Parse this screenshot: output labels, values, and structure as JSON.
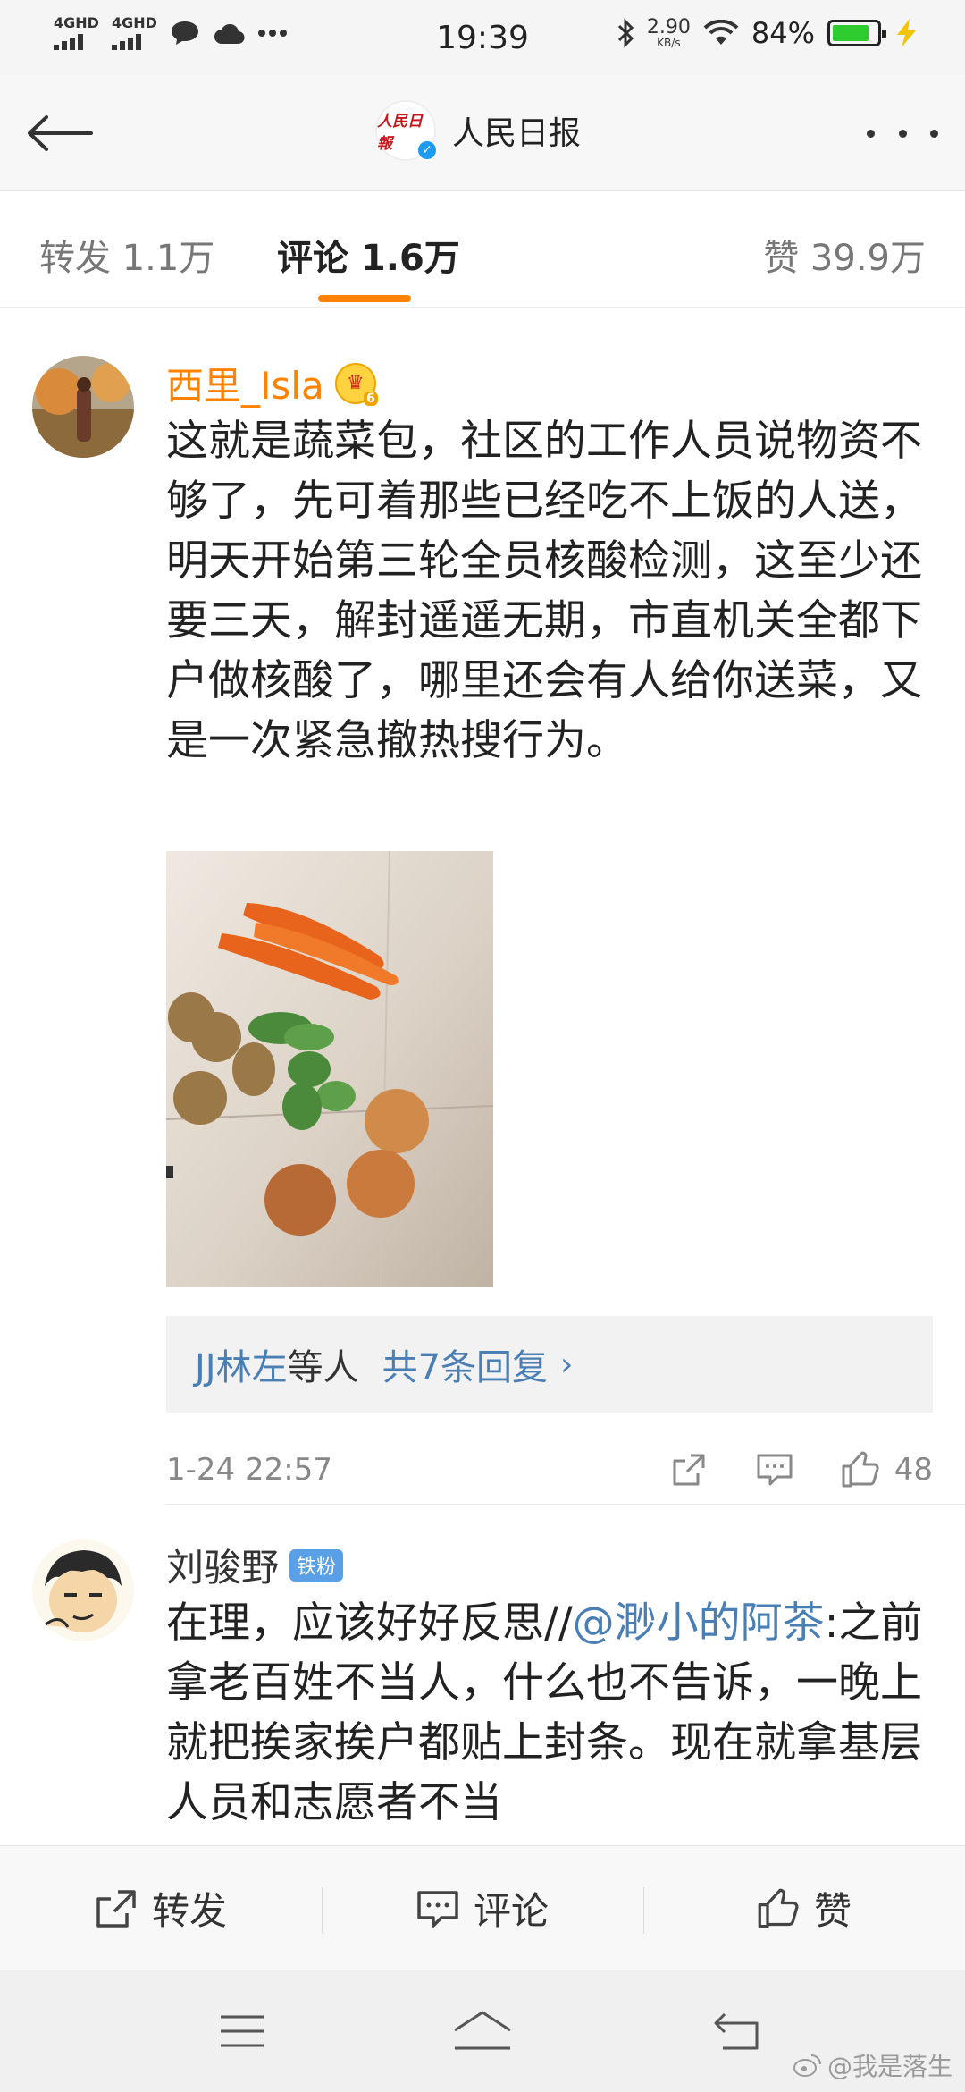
{
  "status_bar": {
    "network_1": "4GHD",
    "network_2": "4GHD",
    "time": "19:39",
    "speed_value": "2.90",
    "speed_unit": "KB/s",
    "battery_percent": "84%",
    "battery_level": 0.84,
    "battery_color": "#2ecc2e"
  },
  "header": {
    "title": "人民日报",
    "logo_text": "人民日報",
    "back_icon": "back-arrow-icon",
    "more_icon": "more-dots-icon"
  },
  "tabs": [
    {
      "label": "转发 1.1万"
    },
    {
      "label": "评论 1.6万"
    },
    {
      "label": "赞 39.9万"
    }
  ],
  "accent_color": "#ff8200",
  "comments": [
    {
      "username": "西里_Isla",
      "username_color": "#ff8200",
      "badge_number": "6",
      "text": "这就是蔬菜包，社区的工作人员说物资不够了，先可着那些已经吃不上饭的人送，明天开始第三轮全员核酸检测，这至少还要三天，解封遥遥无期，市直机关全都下户做核酸了，哪里还会有人给你送菜，又是一次紧急撤热搜行为。",
      "reply_names": "JJ林左",
      "reply_etc": "等人",
      "reply_count": "共7条回复",
      "time": "1-24 22:57",
      "likes": "48"
    },
    {
      "username": "刘骏野",
      "badge": "铁粉",
      "text_prefix": "在理，应该好好反思//",
      "mention": "@渺小的阿茶",
      "text_rest": ":之前拿老百姓不当人，什么也不告诉，一晚上就把挨家挨户都贴上封条。现在就拿基层人员和志愿者不当"
    }
  ],
  "action_bar": [
    {
      "label": "转发",
      "icon": "repost-icon"
    },
    {
      "label": "评论",
      "icon": "comment-icon"
    },
    {
      "label": "赞",
      "icon": "like-icon"
    }
  ],
  "watermark": "@我是落生"
}
